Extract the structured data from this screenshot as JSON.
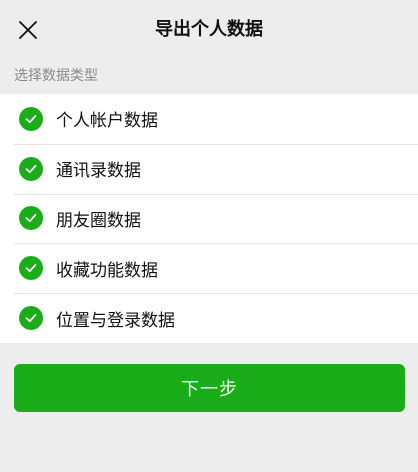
{
  "header": {
    "title": "导出个人数据",
    "close_icon": "close-icon"
  },
  "section": {
    "label": "选择数据类型"
  },
  "items": [
    {
      "label": "个人帐户数据",
      "checked": true,
      "icon": "check-circle-icon"
    },
    {
      "label": "通讯录数据",
      "checked": true,
      "icon": "check-circle-icon"
    },
    {
      "label": "朋友圈数据",
      "checked": true,
      "icon": "check-circle-icon"
    },
    {
      "label": "收藏功能数据",
      "checked": true,
      "icon": "check-circle-icon"
    },
    {
      "label": "位置与登录数据",
      "checked": true,
      "icon": "check-circle-icon"
    }
  ],
  "actions": {
    "next_label": "下一步"
  },
  "colors": {
    "accent": "#1aad19",
    "background": "#ededed",
    "card": "#ffffff",
    "secondary_text": "#8a8a8a"
  }
}
